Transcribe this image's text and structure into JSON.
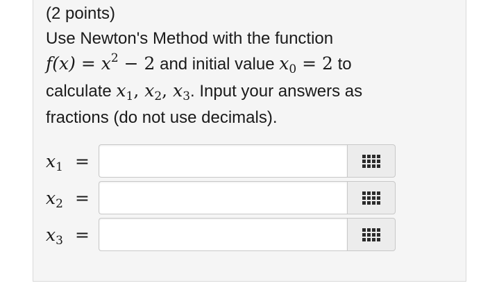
{
  "problem": {
    "points": "(2 points)",
    "line1": "Use Newton's Method with the function",
    "f_lhs": "f(x)",
    "eq": "=",
    "x_base": "x",
    "exp": "2",
    "minus_two": "− 2",
    "initial_text": " and initial value ",
    "x0_var": "x",
    "x0_sub": "0",
    "x0_val": "2",
    "to_text": " to",
    "calc_text": "calculate ",
    "x1_sub": "1",
    "x2_sub": "2",
    "x3_sub": "3",
    "input_text": ". Input your answers as",
    "line4": "fractions (do not use decimals)."
  },
  "answers": [
    {
      "var": "x",
      "sub": "1",
      "eq": "=",
      "value": "",
      "placeholder": ""
    },
    {
      "var": "x",
      "sub": "2",
      "eq": "=",
      "value": "",
      "placeholder": ""
    },
    {
      "var": "x",
      "sub": "3",
      "eq": "=",
      "value": "",
      "placeholder": ""
    }
  ],
  "icons": {
    "palette": "grid-icon"
  }
}
